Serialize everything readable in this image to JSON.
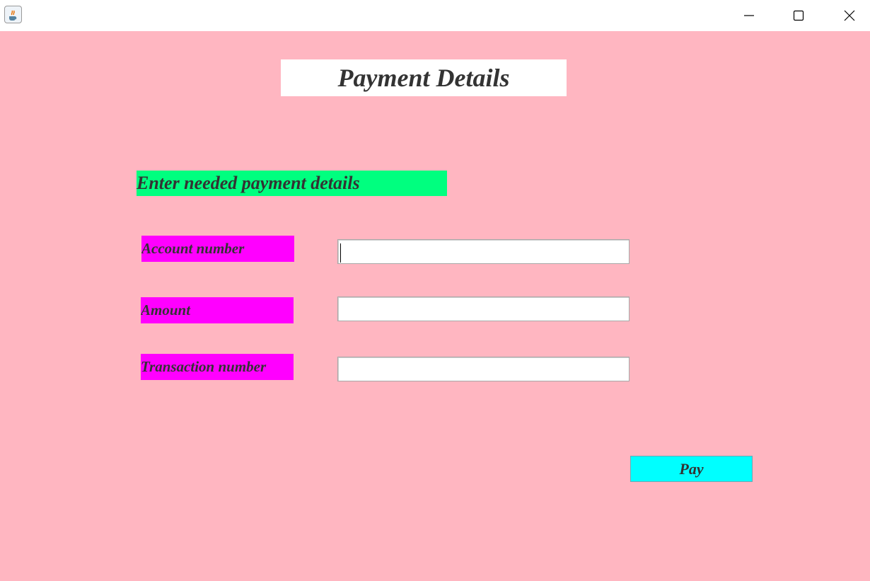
{
  "window": {
    "app_icon": "java-icon",
    "controls": {
      "minimize": "minimize-icon",
      "maximize": "maximize-icon",
      "close": "close-icon"
    }
  },
  "form": {
    "title": "Payment Details",
    "subtitle": "Enter needed payment details",
    "fields": [
      {
        "label": "Account number",
        "value": ""
      },
      {
        "label": "Amount",
        "value": ""
      },
      {
        "label": "Transaction number",
        "value": ""
      }
    ],
    "pay_label": "Pay"
  },
  "colors": {
    "background": "#ffb6c1",
    "subtitle_bg": "#00ff7f",
    "label_bg": "#ff00ff",
    "button_bg": "#00ffff",
    "text": "#333333"
  }
}
